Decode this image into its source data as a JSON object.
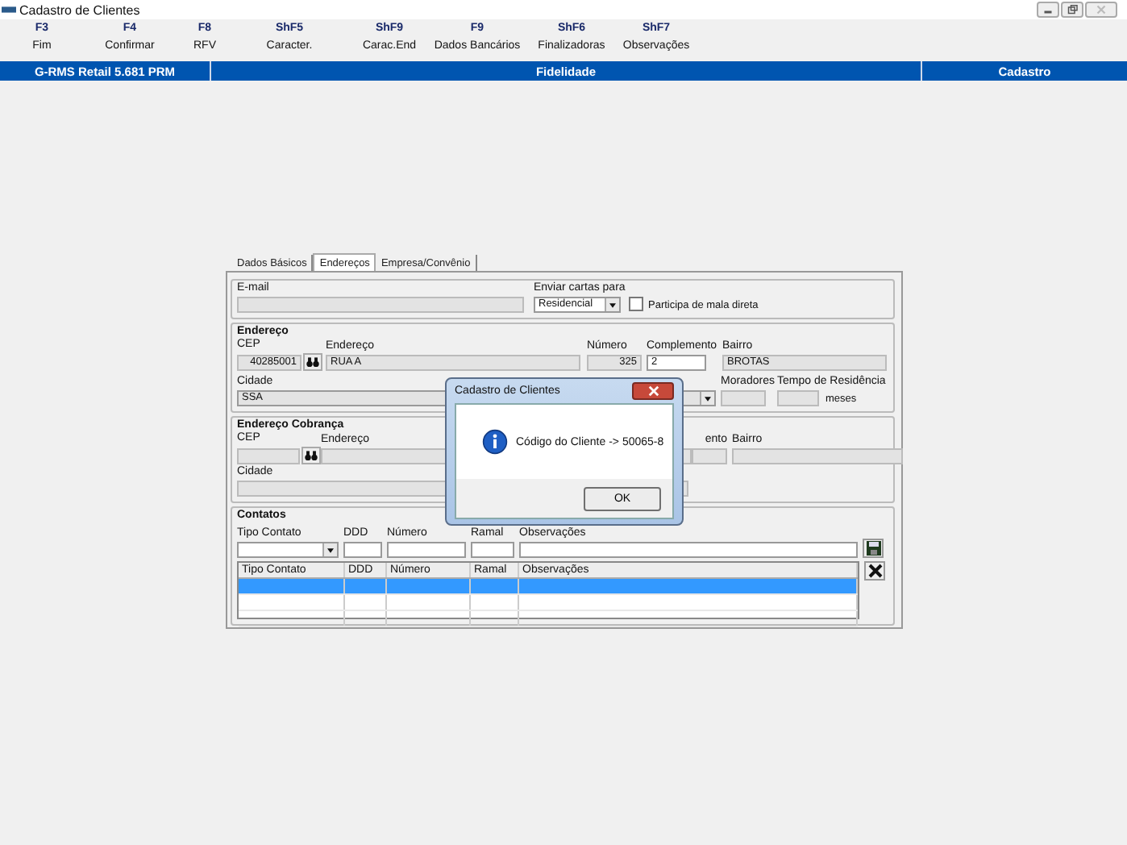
{
  "window": {
    "title": "Cadastro de Clientes"
  },
  "toolbar": [
    {
      "key": "F3",
      "label": "Fim"
    },
    {
      "key": "F4",
      "label": "Confirmar"
    },
    {
      "key": "F8",
      "label": "RFV"
    },
    {
      "key": "ShF5",
      "label": "Caracter."
    },
    {
      "key": "ShF9",
      "label": "Carac.End"
    },
    {
      "key": "F9",
      "label": "Dados Bancários"
    },
    {
      "key": "ShF6",
      "label": "Finalizadoras"
    },
    {
      "key": "ShF7",
      "label": "Observações"
    }
  ],
  "status_bar": {
    "app": "G-RMS Retail 5.681 PRM",
    "module": "Fidelidade",
    "screen": "Cadastro"
  },
  "tabs": [
    {
      "label": "Dados Básicos",
      "selected": false
    },
    {
      "label": "Endereços",
      "selected": true
    },
    {
      "label": "Empresa/Convênio",
      "selected": false
    }
  ],
  "contact_prefs": {
    "email_label": "E-mail",
    "send_label": "Enviar cartas para",
    "send_value": "Residencial",
    "mailing_label": "Participa de mala direta",
    "mailing_checked": false
  },
  "address": {
    "title": "Endereço",
    "cep_label": "CEP",
    "cep": "40285001",
    "street_label": "Endereço",
    "street": "RUA A",
    "number_label": "Número",
    "number": "325",
    "complement_label": "Complemento",
    "complement": "2",
    "district_label": "Bairro",
    "district": "BROTAS",
    "city_label": "Cidade",
    "city": "SSA",
    "residents_label": "Moradores",
    "residence_label": "Tempo de Residência",
    "residence_unit": "meses"
  },
  "billing": {
    "title": "Endereço Cobrança",
    "cep_label": "CEP",
    "street_label": "Endereço",
    "complement_label": "ento",
    "district_label": "Bairro",
    "city_label": "Cidade"
  },
  "contacts": {
    "title": "Contatos",
    "type_label": "Tipo Contato",
    "ddd_label": "DDD",
    "number_label": "Número",
    "ramal_label": "Ramal",
    "notes_label": "Observações",
    "columns": [
      "Tipo Contato",
      "DDD",
      "Número",
      "Ramal",
      "Observações"
    ],
    "rows": [
      {
        "selected": true
      },
      {
        "selected": false
      },
      {
        "selected": false
      }
    ]
  },
  "dialog": {
    "title": "Cadastro de Clientes",
    "message": "Código do Cliente -> 50065-8",
    "button": "OK"
  }
}
